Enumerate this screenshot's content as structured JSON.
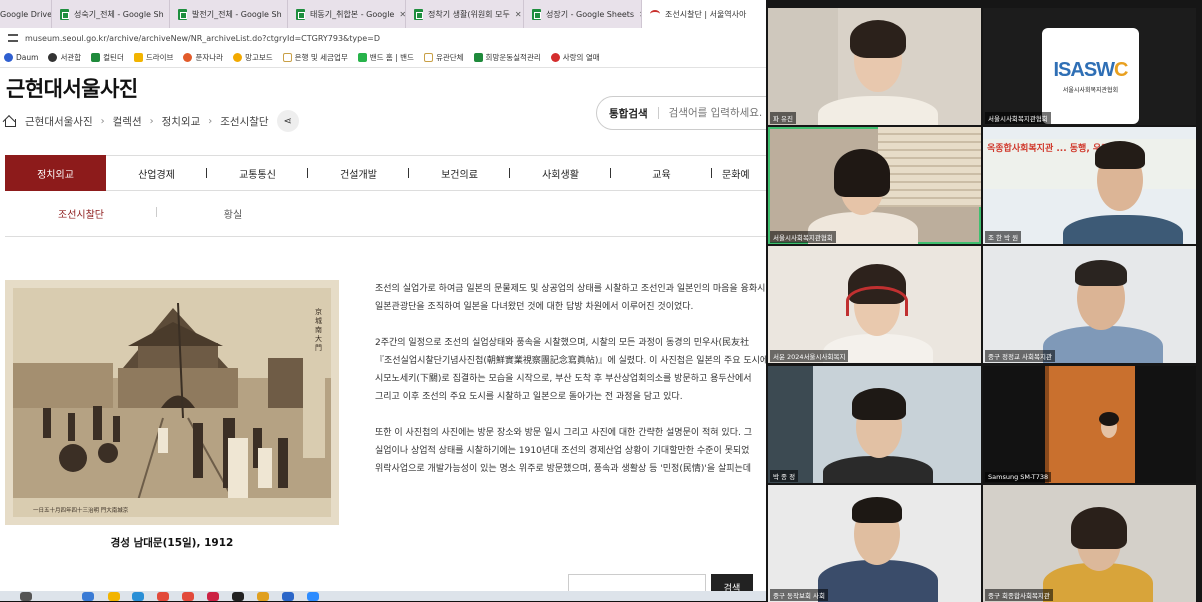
{
  "browser": {
    "tabs": [
      {
        "label": "Google Drive",
        "icon": "none"
      },
      {
        "label": "성숙기_전체 - Google Sh",
        "icon": "sheet-icon"
      },
      {
        "label": "발전기_전체 - Google Sh",
        "icon": "sheet-icon"
      },
      {
        "label": "태동기_취합본 - Google",
        "icon": "sheet-icon"
      },
      {
        "label": "정착기 생활(위원회 모두",
        "icon": "sheet-icon"
      },
      {
        "label": "성장기 - Google Sheets",
        "icon": "sheet-icon"
      },
      {
        "label": "조선시찰단 | 서울역사아",
        "icon": "seoul-icon"
      }
    ],
    "tab_close": "✕",
    "url": "museum.seoul.go.kr/archive/archiveNew/NR_archiveList.do?ctgryId=CTGRY793&type=D",
    "bookmarks": [
      {
        "label": "Daum",
        "color": "#2f5fd0"
      },
      {
        "label": "서관합",
        "color": "#333333"
      },
      {
        "label": "컬틴더",
        "color": "#1f8a3b"
      },
      {
        "label": "드라이브",
        "color": "#f2b400"
      },
      {
        "label": "푼자나라",
        "color": "#e25b2a"
      },
      {
        "label": "망고보드",
        "color": "#f2a900"
      },
      {
        "label": "은행 및 세금업무",
        "color": "#c9a046"
      },
      {
        "label": "밴드 홈 | 밴드",
        "color": "#27b34a"
      },
      {
        "label": "유관단체",
        "color": "#c9a046"
      },
      {
        "label": "희망운동실적관리",
        "color": "#1f8a3b"
      },
      {
        "label": "사랑의 열매",
        "color": "#d42d2d"
      }
    ]
  },
  "page": {
    "title": "근현대서울사진",
    "breadcrumb": [
      "근현대서울사진",
      "컬렉션",
      "정치외교",
      "조선시찰단"
    ],
    "search_label": "통합검색",
    "search_placeholder": "검색어를 입력하세요.",
    "nav": [
      "정치외교",
      "산업경제",
      "교통통신",
      "건설개발",
      "보건의료",
      "사회생활",
      "교육",
      "문화예"
    ],
    "subnav": [
      "조선시찰단",
      "황실"
    ],
    "photo_caption": "경성 남대문(15일), 1912",
    "photo_side_text": "京城南大門",
    "photo_bottom_text": "一日五十月四年四十三治明 門大南城京",
    "article": [
      "조선의 실업가로 하여금 일본의 문물제도 및 상공업의 상태를 시찰하고 조선인과 일본인의 마음을 융화시",
      "일본관광단을 조직하여 일본을 다녀왔던 것에 대한 답방 차원에서 이루어진 것이었다.",
      "2주간의 일정으로 조선의 실업상태와 풍속을 시찰했으며, 시찰의 모든 과정이 동경의 민우사(民友社",
      "『조선실업시찰단기념사진첩(朝鮮實業視察團記念寫眞帖)』에 실렸다. 이 사진첩은 일본의 주요 도시에",
      "시모노세키(下關)로 집결하는 모습을 시작으로, 부산 도착 후 부산상업회의소를 방문하고 용두산에서",
      "그리고 이후 조선의 주요 도시를 시찰하고 일본으로 돌아가는 전 과정을 담고 있다.",
      "또한 이 사진첩의 사진에는 방문 장소와 방문 일시 그리고 사진에 대한 간략한 설명문이 적혀 있다. 그",
      "실업이나 상업적 상태를 시찰하기에는 1910년대 조선의 경제산업 상황이 기대할만한 수준이 못되었",
      "위락사업으로 개발가능성이 있는 명소 위주로 방문했으며, 풍속과 생활상 등 '민정(民情)'을 살피는데"
    ],
    "bottom_button": "검색"
  },
  "zoom": {
    "participants": [
      {
        "name": "파 유진"
      },
      {
        "name": "서울시사회복지관협회"
      },
      {
        "name": "서울시사회복지관협회"
      },
      {
        "name": "조 한 박 원"
      },
      {
        "name": "서윤 2024서울시사회복지"
      },
      {
        "name": "중구 정정교 사회복지관"
      },
      {
        "name": "박 종 정"
      },
      {
        "name": "Samsung SM-T738"
      },
      {
        "name": "중구 동작보회 사회"
      },
      {
        "name": "중구 회종합사회복지관"
      }
    ],
    "logo_text_blue": "ISASW",
    "logo_text_orange": "C",
    "logo_subtitle": "서울시사회복지관협회",
    "banner_text": "옥종합사회복지관 ... 동행, 우리"
  }
}
